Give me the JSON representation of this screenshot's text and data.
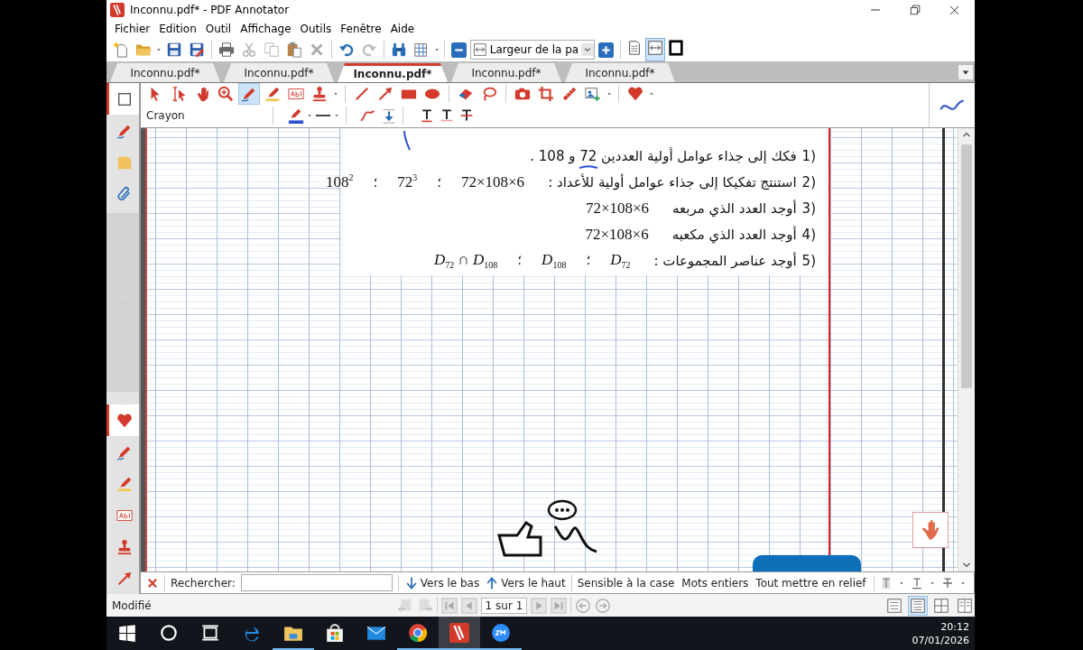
{
  "window": {
    "title": "Inconnu.pdf* - PDF Annotator"
  },
  "menu": [
    "Fichier",
    "Edition",
    "Outil",
    "Affichage",
    "Outils",
    "Fenêtre",
    "Aide"
  ],
  "toolbar": {
    "buttons": [
      {
        "disabled": false
      },
      {
        "disabled": false
      },
      {
        "disabled": false
      },
      {
        "disabled": false
      },
      {
        "disabled": false
      },
      {
        "disabled": true
      },
      {
        "disabled": true
      },
      {
        "disabled": false
      },
      {
        "disabled": true
      },
      {
        "disabled": false
      },
      {
        "disabled": true
      },
      {
        "disabled": false
      },
      {
        "disabled": false
      }
    ],
    "zoom_select": {
      "value": "Largeur de la pa"
    },
    "view_buttons": [
      {
        "selected": false
      },
      {
        "selected": true
      },
      {
        "selected": false
      }
    ]
  },
  "tabs": [
    {
      "label": "Inconnu.pdf*",
      "selected": false
    },
    {
      "label": "Inconnu.pdf*",
      "selected": false
    },
    {
      "label": "Inconnu.pdf*",
      "selected": true
    },
    {
      "label": "Inconnu.pdf*",
      "selected": false
    },
    {
      "label": "Inconnu.pdf*",
      "selected": false
    }
  ],
  "annotation_toolbar": {
    "tools": [
      {
        "selected": false
      },
      {
        "selected": false
      },
      {
        "selected": false
      },
      {
        "selected": false
      },
      {
        "selected": true
      },
      {
        "selected": false
      },
      {
        "selected": false
      },
      {
        "selected": false
      },
      {
        "selected": false
      },
      {
        "selected": false
      },
      {
        "selected": false
      },
      {
        "selected": false
      },
      {
        "selected": false
      },
      {
        "selected": false
      },
      {
        "selected": false
      },
      {
        "selected": false
      },
      {
        "selected": false
      },
      {
        "selected": false
      },
      {
        "selected": false
      }
    ],
    "tool_name": "Crayon"
  },
  "sidebar": {
    "upper": [
      {
        "selected": true
      },
      {
        "selected": false
      },
      {
        "selected": false
      },
      {
        "selected": false
      }
    ],
    "lower": [
      {
        "selected": true
      },
      {
        "selected": false
      },
      {
        "selected": false
      },
      {
        "selected": false
      },
      {
        "selected": false
      },
      {
        "selected": false
      }
    ]
  },
  "document": {
    "lines": [
      {
        "number": "1)",
        "text": "فكك إلى جذاء عوامل أولية العددين 72 و 108 ."
      },
      {
        "number": "2)",
        "text": "استنتج تفكيكا إلى جذاء عوامل أولية للأعداد :",
        "math": [
          {
            "kind": "expr",
            "text": "108$^{2}$"
          },
          {
            "kind": "sep",
            "text": "؛"
          },
          {
            "kind": "expr",
            "text": "72$^{3}$"
          },
          {
            "kind": "sep",
            "text": "؛"
          },
          {
            "kind": "expr",
            "text": "72×108×6"
          }
        ]
      },
      {
        "number": "3)",
        "text": "أوجد العدد الذي مربعه",
        "math": [
          {
            "kind": "expr",
            "text": "72×108×6"
          }
        ]
      },
      {
        "number": "4)",
        "text": "أوجد العدد الذي مكعبه",
        "math": [
          {
            "kind": "expr",
            "text": "72×108×6"
          }
        ]
      },
      {
        "number": "5)",
        "text": "أوجد عناصر المجموعات :",
        "math": [
          {
            "kind": "expr",
            "text": "*D*$_{72}$ ∩ *D*$_{108}$"
          },
          {
            "kind": "sep",
            "text": "؛"
          },
          {
            "kind": "expr",
            "text": "*D*$_{108}$"
          },
          {
            "kind": "sep",
            "text": "؛"
          },
          {
            "kind": "expr",
            "text": "*D*$_{72}$"
          }
        ]
      }
    ]
  },
  "search_bar": {
    "label": "Rechercher:",
    "buttons": [
      "Vers le bas",
      "Vers le haut"
    ],
    "options": [
      "Sensible à la case",
      "Mots entiers",
      "Tout mettre en relief"
    ]
  },
  "status_bar": {
    "status": "Modifié",
    "page": "1 sur 1",
    "layout_buttons": [
      {
        "selected": false
      },
      {
        "selected": true
      },
      {
        "selected": false
      },
      {
        "selected": false
      }
    ]
  },
  "taskbar": {
    "apps": [
      {
        "selected": false,
        "running": false
      },
      {
        "selected": false,
        "running": false
      },
      {
        "selected": false,
        "running": false
      },
      {
        "selected": false,
        "running": false
      },
      {
        "selected": false,
        "running": true
      },
      {
        "selected": false,
        "running": false
      },
      {
        "selected": false,
        "running": false
      },
      {
        "selected": false,
        "running": true
      },
      {
        "selected": true,
        "running": true
      },
      {
        "selected": false,
        "running": true
      }
    ],
    "time": "20:12",
    "date": "07/01/2026"
  }
}
